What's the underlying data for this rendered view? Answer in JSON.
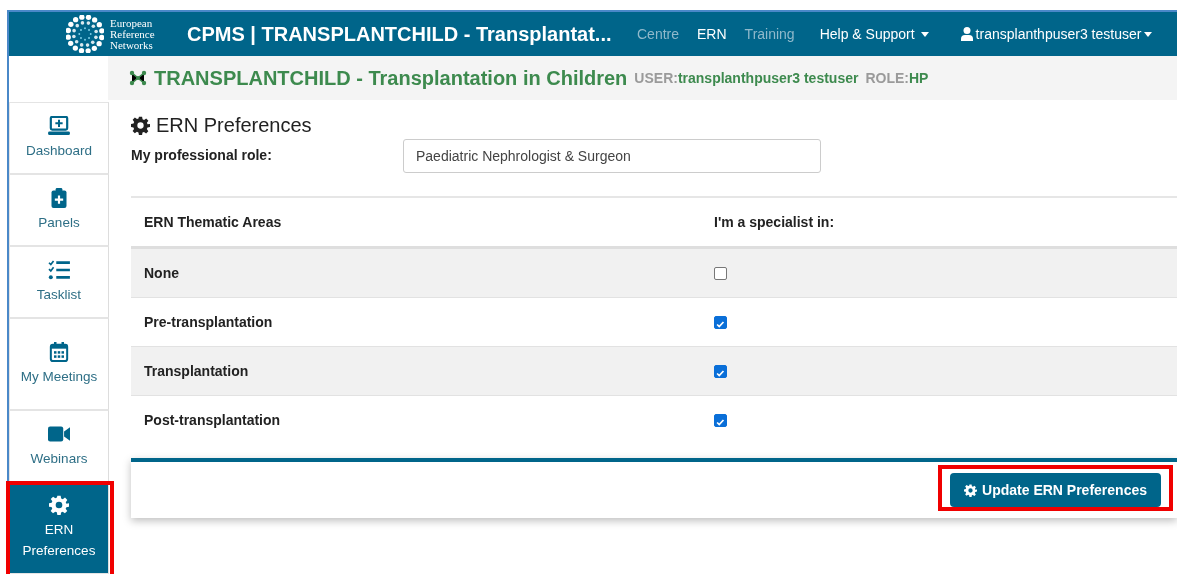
{
  "header": {
    "logo_text": [
      "European",
      "Reference",
      "Networks"
    ],
    "title": "CPMS | TRANSPLANTCHILD - Transplantat...",
    "nav": [
      {
        "label": "Centre",
        "selected": false
      },
      {
        "label": "ERN",
        "selected": true
      },
      {
        "label": "Training",
        "selected": false
      }
    ],
    "help_menu": "Help & Support",
    "user_menu": "transplanthpuser3 testuser"
  },
  "subheader": {
    "network": "TRANSPLANTCHILD - Transplantation in Children",
    "user_label": "USER:",
    "user": "transplanthpuser3 testuser",
    "role_label": "ROLE:",
    "role": "HP"
  },
  "sidebar": {
    "items": [
      {
        "kind": "dashboard",
        "label": "Dashboard",
        "selected": false,
        "highlighted": false
      },
      {
        "kind": "panels",
        "label": "Panels",
        "selected": false,
        "highlighted": false
      },
      {
        "kind": "tasklist",
        "label": "Tasklist",
        "selected": false,
        "highlighted": false
      },
      {
        "kind": "meetings",
        "label": "My Meetings",
        "selected": false,
        "highlighted": false
      },
      {
        "kind": "webinars",
        "label": "Webinars",
        "selected": false,
        "highlighted": false
      },
      {
        "kind": "preferences",
        "label": "ERN Preferences",
        "selected": true,
        "highlighted": true
      }
    ]
  },
  "page": {
    "title": "ERN Preferences",
    "role_label": "My professional role:",
    "role_value": "Paediatric Nephrologist & Surgeon",
    "table": {
      "columns": [
        "ERN Thematic Areas",
        "I'm a specialist in:"
      ],
      "rows": [
        {
          "area": "None",
          "checked": false
        },
        {
          "area": "Pre-transplantation",
          "checked": true
        },
        {
          "area": "Transplantation",
          "checked": true
        },
        {
          "area": "Post-transplantation",
          "checked": true
        }
      ]
    },
    "update_button": {
      "label": "Update ERN Preferences",
      "highlighted": true
    }
  }
}
